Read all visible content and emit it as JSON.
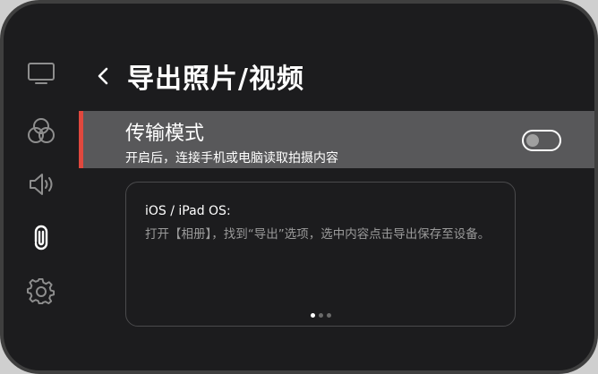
{
  "sidebar": {
    "items": [
      {
        "icon": "monitor-icon"
      },
      {
        "icon": "color-circles-icon"
      },
      {
        "icon": "speaker-icon"
      },
      {
        "icon": "paperclip-icon",
        "active": true
      },
      {
        "icon": "gear-icon"
      }
    ]
  },
  "header": {
    "back_icon": "chevron-left-icon",
    "title": "导出照片/视频"
  },
  "transfer_mode": {
    "title": "传输模式",
    "description": "开启后，连接手机或电脑读取拍摄内容",
    "toggle_on": false,
    "accent_color": "#e0483e"
  },
  "instruction_card": {
    "heading": "iOS / iPad OS:",
    "text": "打开【相册】，找到“导出”选项，选中内容点击导出保存至设备。",
    "page_count": 3,
    "current_page": 1
  }
}
